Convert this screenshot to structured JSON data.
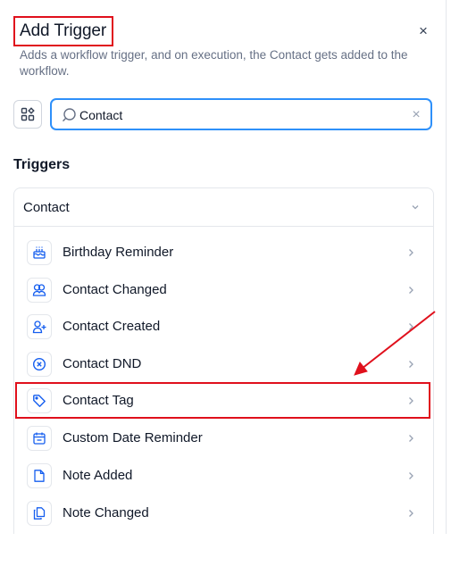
{
  "header": {
    "title": "Add Trigger",
    "close_glyph": "×",
    "subtitle": "Adds a workflow trigger, and on execution, the Contact gets added to the workflow."
  },
  "search": {
    "value": "Contact",
    "clear_glyph": "×"
  },
  "section": {
    "title": "Triggers"
  },
  "group": {
    "title": "Contact",
    "items": [
      {
        "label": "Birthday Reminder",
        "icon": "cake-icon"
      },
      {
        "label": "Contact Changed",
        "icon": "users-icon"
      },
      {
        "label": "Contact Created",
        "icon": "user-plus-icon"
      },
      {
        "label": "Contact DND",
        "icon": "x-circle-icon"
      },
      {
        "label": "Contact Tag",
        "icon": "tag-icon"
      },
      {
        "label": "Custom Date Reminder",
        "icon": "calendar-icon"
      },
      {
        "label": "Note Added",
        "icon": "file-icon"
      },
      {
        "label": "Note Changed",
        "icon": "files-icon"
      }
    ]
  },
  "colors": {
    "accent": "#2e90fa",
    "icon_blue": "#155eef",
    "annotation_red": "#e0101c"
  }
}
